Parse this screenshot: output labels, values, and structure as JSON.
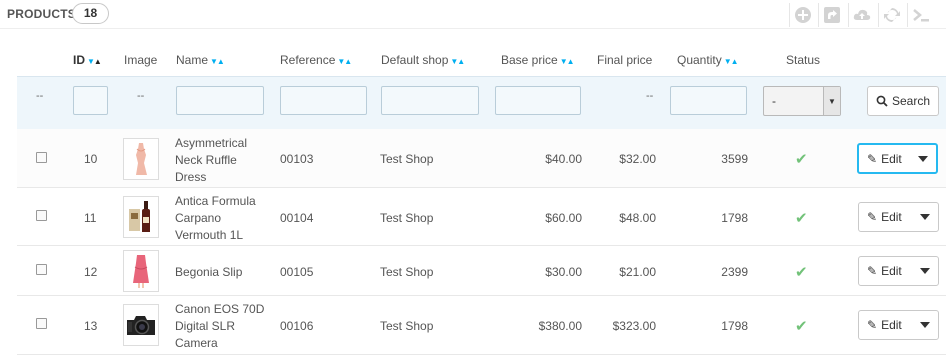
{
  "panel": {
    "title": "PRODUCTS",
    "count": "18"
  },
  "toolbar": [
    "add-icon",
    "export-icon",
    "cloud-upload-icon",
    "refresh-icon",
    "sql-terminal-icon"
  ],
  "columns": {
    "id": "ID",
    "image": "Image",
    "name": "Name",
    "reference": "Reference",
    "default_shop": "Default shop",
    "base_price": "Base price",
    "final_price": "Final price",
    "quantity": "Quantity",
    "status": "Status"
  },
  "filters": {
    "select_value": "-",
    "dash": "--",
    "search_label": "Search"
  },
  "rows": [
    {
      "id": "10",
      "name": "Asymmetrical Neck Ruffle Dress",
      "reference": "00103",
      "shop": "Test Shop",
      "base": "$40.00",
      "final": "$32.00",
      "qty": "3599",
      "edit": "Edit"
    },
    {
      "id": "11",
      "name": "Antica Formula Carpano Vermouth 1L",
      "reference": "00104",
      "shop": "Test Shop",
      "base": "$60.00",
      "final": "$48.00",
      "qty": "1798",
      "edit": "Edit"
    },
    {
      "id": "12",
      "name": "Begonia Slip",
      "reference": "00105",
      "shop": "Test Shop",
      "base": "$30.00",
      "final": "$21.00",
      "qty": "2399",
      "edit": "Edit"
    },
    {
      "id": "13",
      "name": "Canon EOS 70D Digital SLR Camera",
      "reference": "00106",
      "shop": "Test Shop",
      "base": "$380.00",
      "final": "$323.00",
      "qty": "1798",
      "edit": "Edit"
    }
  ],
  "colors": {
    "accent": "#00aff0",
    "status_ok": "#72c279",
    "focus": "#25b9f0"
  }
}
